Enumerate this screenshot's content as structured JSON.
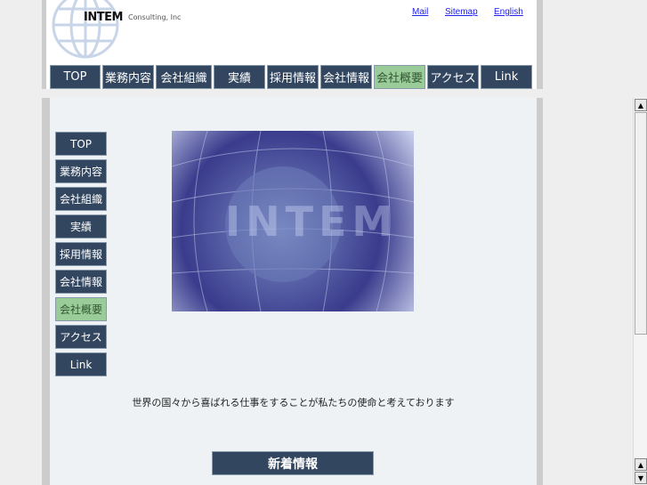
{
  "header": {
    "logo": "INTEM",
    "logo_sub": "Consulting, Inc",
    "links": [
      "Mail",
      "Sitemap",
      "English"
    ]
  },
  "nav": [
    {
      "label": "TOP"
    },
    {
      "label": "業務内容"
    },
    {
      "label": "会社組織"
    },
    {
      "label": "実績"
    },
    {
      "label": "採用情報"
    },
    {
      "label": "会社情報"
    },
    {
      "label": "会社概要",
      "active": true
    },
    {
      "label": "アクセス"
    },
    {
      "label": "Link"
    }
  ],
  "main": {
    "tagline": "世界の国々から喜ばれる仕事をすることが私たちの使命と考えております",
    "news_label": "新着情報",
    "hero_text": "INTEM"
  },
  "scrollbar": {
    "up": "▲",
    "down": "▼"
  }
}
